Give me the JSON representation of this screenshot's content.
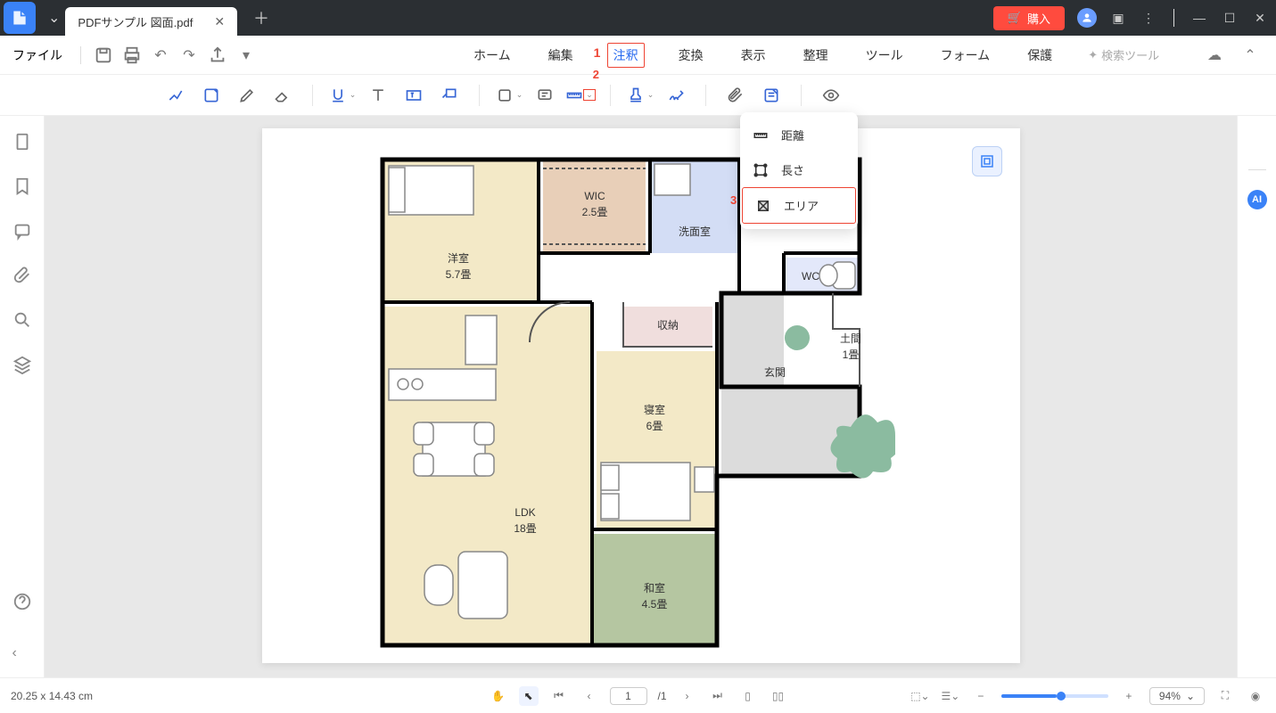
{
  "titlebar": {
    "tab_name": "PDFサンプル 図面.pdf",
    "buy_label": "購入"
  },
  "menubar": {
    "file": "ファイル",
    "items": [
      "ホーム",
      "編集",
      "注釈",
      "変換",
      "表示",
      "整理",
      "ツール",
      "フォーム",
      "保護"
    ],
    "search": "検索ツール",
    "annotation_1": "1",
    "annotation_2": "2"
  },
  "dropdown": {
    "items": [
      "距離",
      "長さ",
      "エリア"
    ],
    "annotation_3": "3"
  },
  "rightbar": {
    "ai": "AI"
  },
  "floorplan": {
    "rooms": {
      "wic": {
        "name": "WIC",
        "size": "2.5畳"
      },
      "bedroom_west": {
        "name": "洋室",
        "size": "5.7畳"
      },
      "wash": {
        "name": "洗面室"
      },
      "wc": {
        "name": "WC"
      },
      "storage": {
        "name": "収納"
      },
      "doma": {
        "name": "土間",
        "size": "1畳"
      },
      "genkan": {
        "name": "玄関"
      },
      "bedroom_main": {
        "name": "寝室",
        "size": "6畳"
      },
      "ldk": {
        "name": "LDK",
        "size": "18畳"
      },
      "tatami": {
        "name": "和室",
        "size": "4.5畳"
      }
    }
  },
  "statusbar": {
    "dimensions": "20.25 x 14.43 cm",
    "page_current": "1",
    "page_total": "/1",
    "zoom": "94%"
  }
}
